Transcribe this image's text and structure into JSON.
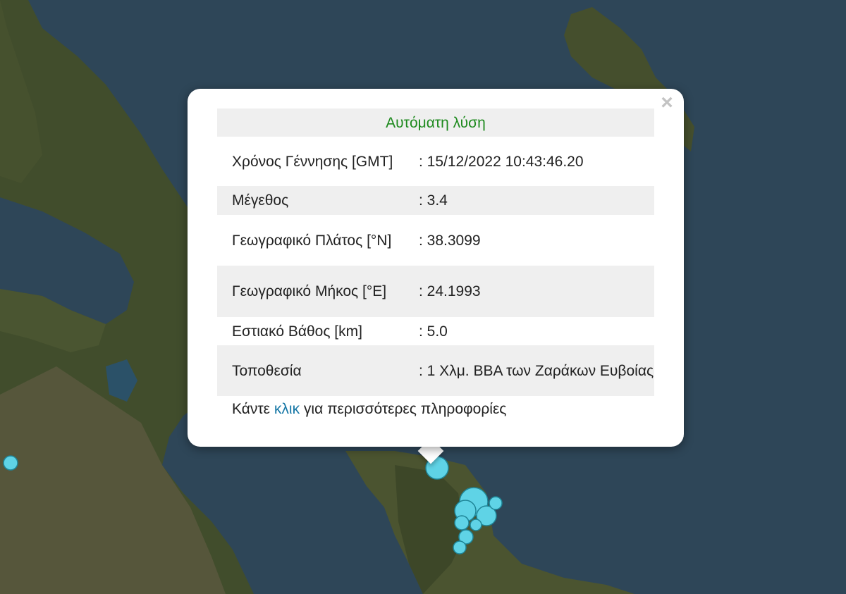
{
  "map": {
    "colors": {
      "sea": "#2e4658",
      "land_dark": "#3d4a2a",
      "land_light": "#6b6248",
      "marker_fill": "#5fd3e6",
      "marker_stroke": "#1f8597"
    },
    "markers": [
      {
        "label": "epicenter-main",
        "lat": 38.3099,
        "lon": 24.1993
      }
    ]
  },
  "popup": {
    "title": "Αυτόματη λύση",
    "close_icon": "×",
    "rows": [
      {
        "label": "Χρόνος Γέννησης [GMT]",
        "value": ": 15/12/2022 10:43:46.20"
      },
      {
        "label": "Μέγεθος",
        "value": ": 3.4"
      },
      {
        "label": "Γεωγραφικό Πλάτος [°N]",
        "value": ": 38.3099"
      },
      {
        "label": "Γεωγραφικό Μήκος [°E]",
        "value": ": 24.1993"
      },
      {
        "label": "Εστιακό Βάθος [km]",
        "value": ": 5.0"
      },
      {
        "label": "Τοποθεσία",
        "value": ": 1 Χλμ. ΒΒΑ των Ζαράκων Ευβοίας"
      }
    ],
    "more_prefix": "Κάντε",
    "more_link": "κλικ",
    "more_suffix": "για περισσότερες πληροφορίες"
  }
}
